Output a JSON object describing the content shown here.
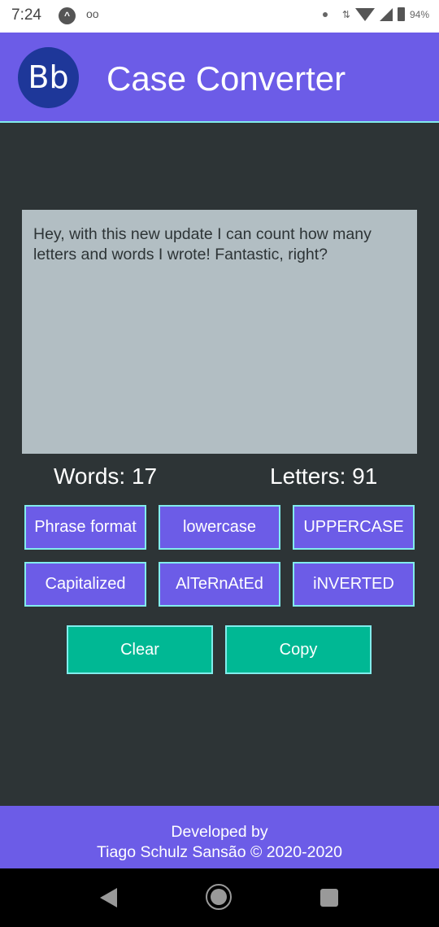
{
  "status_bar": {
    "time": "7:24",
    "notification_icons": [
      "app-a-icon",
      "voicemail-icon"
    ],
    "battery": "94%",
    "icons": [
      "dot-icon",
      "data-arrows-icon",
      "wifi-icon",
      "signal-icon",
      "battery-icon"
    ]
  },
  "app_bar": {
    "logo_text": "Bb",
    "title": "Case Converter"
  },
  "editor": {
    "text": "Hey, with this new update I can count how many letters and words I wrote! Fantastic, right?"
  },
  "counts": {
    "words": "Words: 17",
    "letters": "Letters: 91"
  },
  "case_buttons": [
    {
      "label": "Phrase format"
    },
    {
      "label": "lowercase"
    },
    {
      "label": "UPPERCASE"
    },
    {
      "label": "Capitalized"
    },
    {
      "label": "AlTeRnAtEd"
    },
    {
      "label": "iNVERTED"
    }
  ],
  "actions": {
    "clear": "Clear",
    "copy": "Copy"
  },
  "footer": {
    "line1": "Developed by",
    "line2": "Tiago Schulz Sansão © 2020-2020"
  },
  "colors": {
    "primary": "#6c5ce7",
    "accent": "#00b894",
    "border": "#81ecec",
    "background": "#2d3436",
    "editor_bg": "#b2bec3"
  }
}
